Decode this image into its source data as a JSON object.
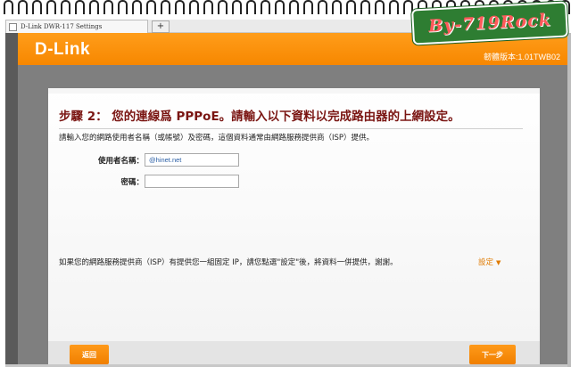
{
  "watermark": "By-719Rock",
  "browser": {
    "tab_title": "D-Link DWR-117 Settings",
    "new_tab_symbol": "+"
  },
  "header": {
    "logo": "D-Link",
    "firmware": "韌體版本:1.01TWB02"
  },
  "wizard": {
    "title": "步驟 2： 您的連線爲 PPPoE。請輸入以下資料以完成路由器的上網設定。",
    "description": "請輸入您的網路使用者名稱（或帳號）及密碼，這個資料通常由網路服務提供商（ISP）提供。",
    "username_label": "使用者名稱：",
    "username_value": "@hinet.net",
    "password_label": "密碼：",
    "password_value": "",
    "static_ip_note": "如果您的網路服務提供商（ISP）有提供您一組固定 IP，請您點選\"設定\"後，將資料一併提供，謝謝。",
    "setting_link": "設定",
    "setting_arrow": "▼",
    "back_button": "返回",
    "next_button": "下一步"
  },
  "colors": {
    "accent": "#f78700",
    "title": "#7a1512",
    "watermark_bg": "#2e7d32"
  }
}
